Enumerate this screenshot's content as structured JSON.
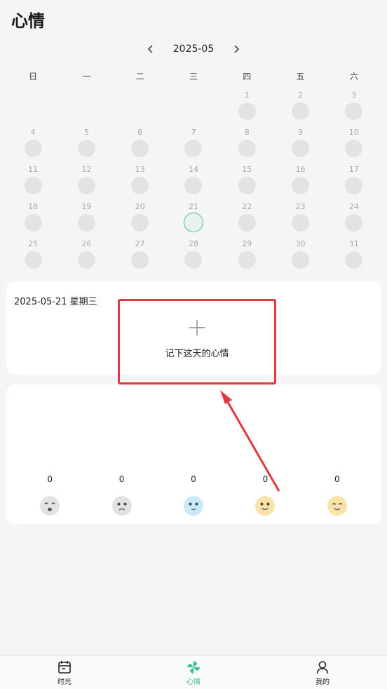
{
  "header": {
    "title": "心情"
  },
  "month_nav": {
    "label": "2025-05",
    "prev_icon": "chevron-left-icon",
    "next_icon": "chevron-right-icon"
  },
  "weekdays": [
    "日",
    "一",
    "二",
    "三",
    "四",
    "五",
    "六"
  ],
  "calendar": {
    "leading_blank_days": 4,
    "days": [
      "1",
      "2",
      "3",
      "4",
      "5",
      "6",
      "7",
      "8",
      "9",
      "10",
      "11",
      "12",
      "13",
      "14",
      "15",
      "16",
      "17",
      "18",
      "19",
      "20",
      "21",
      "22",
      "23",
      "24",
      "25",
      "26",
      "27",
      "28",
      "29",
      "30",
      "31"
    ],
    "selected_day": "21"
  },
  "record_card": {
    "date": "2025-05-21 星期三",
    "add_label": "记下这天的心情"
  },
  "mood_stats": [
    {
      "count": "0",
      "icon": "crying-face-icon",
      "color": "#e2e2e4"
    },
    {
      "count": "0",
      "icon": "sad-face-icon",
      "color": "#e2e2e4"
    },
    {
      "count": "0",
      "icon": "neutral-face-icon",
      "color": "#c8e9f6"
    },
    {
      "count": "0",
      "icon": "smile-face-icon",
      "color": "#fbe2a8"
    },
    {
      "count": "0",
      "icon": "happy-face-icon",
      "color": "#fbe2a8"
    }
  ],
  "tabs": [
    {
      "label": "时光",
      "icon": "calendar-icon",
      "active": false
    },
    {
      "label": "心情",
      "icon": "pinwheel-icon",
      "active": true
    },
    {
      "label": "我的",
      "icon": "person-icon",
      "active": false
    }
  ],
  "colors": {
    "accent": "#3cbf95",
    "highlight": "#e03a3e"
  }
}
